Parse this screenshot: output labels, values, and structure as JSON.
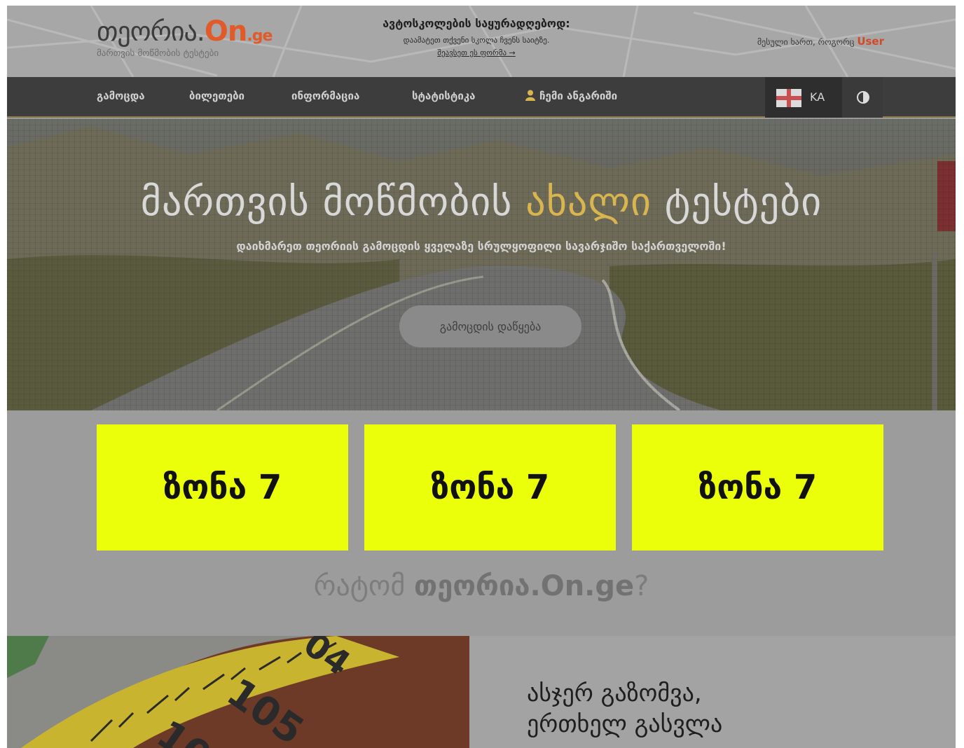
{
  "header": {
    "logo_main": "თეორია.",
    "logo_on": "On",
    "logo_ge": ".ge",
    "logo_sub": "მართვის მოწმობის ტესტები",
    "notice_title": "ავტოსკოლების საყურადღებოდ:",
    "notice_text": "დაამატეთ თქვენი სკოლა ჩვენს საიტზე.",
    "notice_link": "შეავსეთ ეს ფორმა →",
    "greeting": "მესული ხართ, როგორც",
    "greeting_user": "User"
  },
  "nav": {
    "items": [
      {
        "label": "გამოცდა"
      },
      {
        "label": "ბილეთები"
      },
      {
        "label": "ინფორმაცია"
      },
      {
        "label": "სტატისტიკა"
      },
      {
        "label": "ჩემი ანგარიში",
        "icon": "user-icon"
      }
    ],
    "language": "KA",
    "flag_icon": "georgia-flag-icon",
    "contrast_icon": "contrast-icon"
  },
  "hero": {
    "title_part1": "მართვის მოწმობის",
    "title_accent": "ახალი",
    "title_part2": "ტესტები",
    "subtitle": "დაიხმარეთ თეორიის გამოცდის ყველაზე სრულყოფილი სავარჯიშო საქართველოში!",
    "button": "გამოცდის დაწყება"
  },
  "zones": [
    {
      "label": "ზონა 7"
    },
    {
      "label": "ზონა 7"
    },
    {
      "label": "ზონა 7"
    }
  ],
  "why": {
    "prefix": "რატომ",
    "brand": "თეორია.On.ge",
    "suffix": "?"
  },
  "measure": {
    "line1": "ასჯერ გაზომვა,",
    "line2": "ერთხელ გასვლა"
  },
  "colors": {
    "accent_orange": "#e05a2a",
    "accent_gold": "#d9b550",
    "zone_yellow": "#ecff0a",
    "nav_bg": "#3d3d3d"
  }
}
